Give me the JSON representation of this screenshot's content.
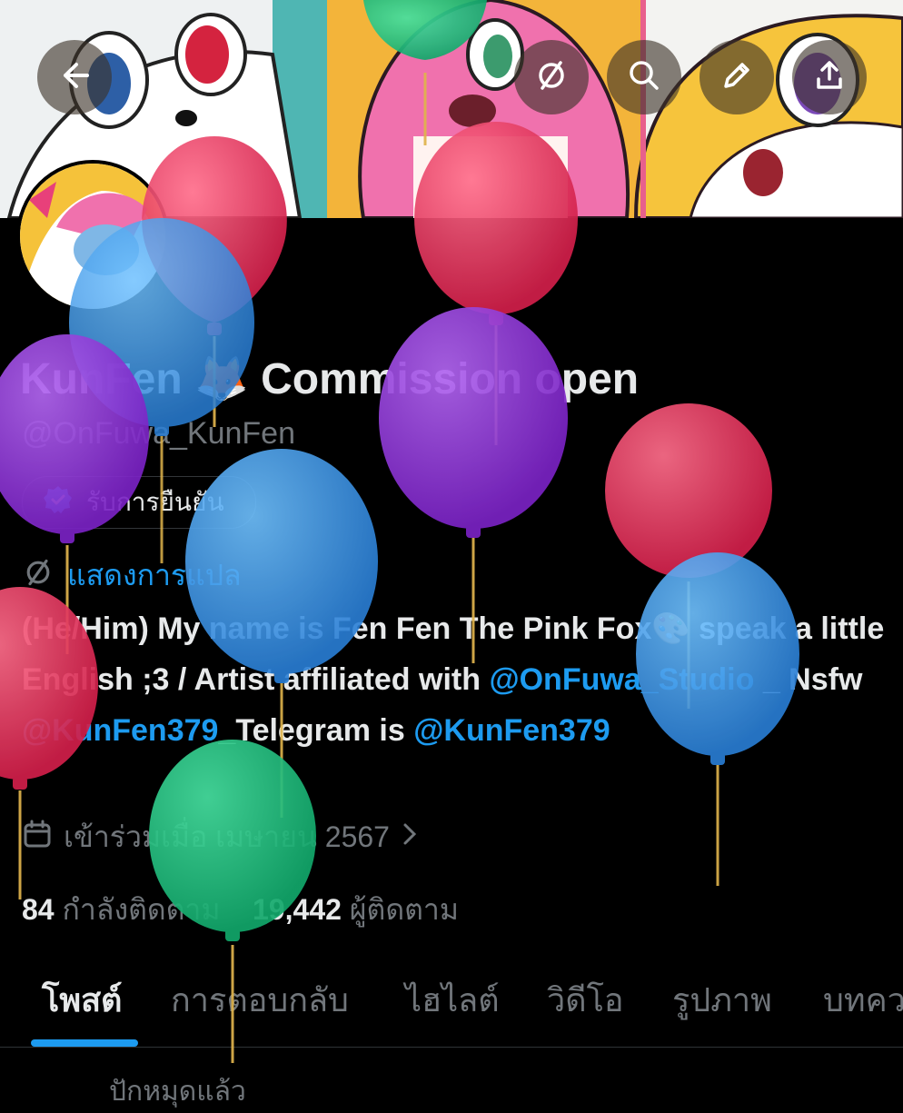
{
  "header": {
    "back_icon": "arrow-left-icon",
    "action_icons": [
      "translate-off-icon",
      "search-icon",
      "pencil-icon",
      "share-icon"
    ]
  },
  "profile": {
    "display_name": "KunFen 🦊 Commission open",
    "handle": "@OnFuwa_KunFen",
    "verify_label": "รับการยืนยัน",
    "translate_label": "แสดงการแปล",
    "bio": {
      "part1": "(He/Him) My name is Fen Fen The Pink Fox🎨 speak a little English ;3 / Artist affiliated with ",
      "mention1": "@OnFuwa_Studio",
      "part2": " _ Nsfw ",
      "mention2": "@KunFen379",
      "part3": "_Telegram is ",
      "mention3": "@KunFen379"
    },
    "joined": "เข้าร่วมเมื่อ เมษายน 2567",
    "following_count": "84",
    "following_label": "กำลังติดตาม",
    "followers_count": "19,442",
    "followers_label": "ผู้ติดตาม"
  },
  "tabs": [
    "โพสต์",
    "การตอบกลับ",
    "ไฮไลต์",
    "วิดีโอ",
    "รูปภาพ",
    "บทความ"
  ],
  "below_tabs": "ปักหมุดแล้ว",
  "colors": {
    "accent": "#1d9bf0",
    "balloon_red": "#e8335c",
    "balloon_blue": "#3a8fe0",
    "balloon_purple": "#8b2fd6",
    "balloon_green": "#1fc37f"
  }
}
